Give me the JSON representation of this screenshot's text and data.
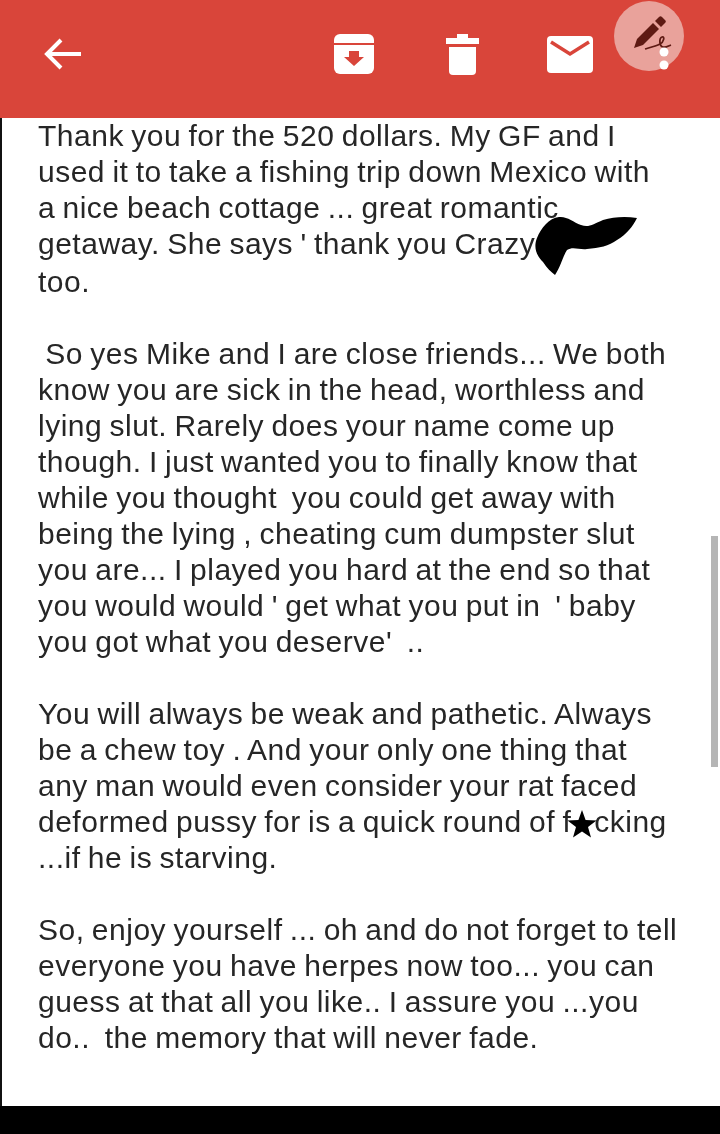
{
  "email": {
    "paragraphs": [
      {
        "parts": [
          {
            "kind": "text",
            "text": "Thank you for the 520 dollars. My GF and I\nused it to take a fishing trip down Mexico with\na nice beach cottage ... great romantic\ngetaway. She says ' thank you Crazy"
          },
          {
            "kind": "blot"
          },
          {
            "kind": "text",
            "text": "\ntoo."
          }
        ]
      },
      {
        "parts": [
          {
            "kind": "text",
            "text": " So yes Mike and I are close friends... We both\nknow you are sick in the head, worthless and\nlying slut. Rarely does your name come up\nthough. I just wanted you to finally know that\nwhile you thought  you could get away with\nbeing the lying , cheating cum dumpster slut\nyou are... I played you hard at the end so that\nyou would would ' get what you put in  ' baby\nyou got what you deserve'  .."
          }
        ]
      },
      {
        "parts": [
          {
            "kind": "text",
            "text": "You will always be weak and pathetic. Always\nbe a chew toy . And your only one thing that\nany man would even consider your rat faced\ndeformed pussy for is a quick round of f"
          },
          {
            "kind": "star"
          },
          {
            "kind": "text",
            "text": "cking\n...if he is starving."
          }
        ]
      },
      {
        "parts": [
          {
            "kind": "text",
            "text": "So, enjoy yourself ... oh and do not forget to tell\neveryone you have herpes now too... you can\nguess at that all you like.. I assure you ...you\ndo..  the memory that will never fade."
          }
        ]
      }
    ]
  }
}
